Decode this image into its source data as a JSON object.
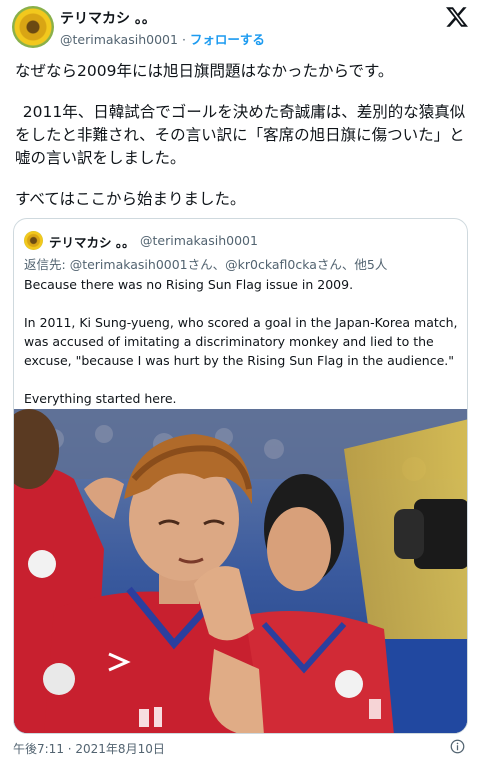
{
  "author": {
    "display_name": "テリマカシ 。。",
    "handle": "@terimakasih0001",
    "separator": "·",
    "follow_label": "フォローする"
  },
  "icons": {
    "brand": "x-logo-icon",
    "info": "info-icon",
    "avatar": "sunflower-avatar"
  },
  "tweet": {
    "line1": "なぜなら2009年には旭日旗問題はなかったからです。",
    "line2": "2011年、日韓試合でゴールを決めた奇誠庸は、差別的な猿真似をしたと非難され、その言い訳に「客席の旭日旗に傷ついた」と嘘の言い訳をしました。",
    "line3": "すべてはここから始まりました。"
  },
  "quote": {
    "display_name": "テリマカシ 。。",
    "handle": "@terimakasih0001",
    "reply_prefix": "返信先: ",
    "reply_mentions": "@terimakasih0001さん、@kr0ckafl0ckaさん、他5人",
    "text1": "Because there was no Rising Sun Flag issue in 2009.",
    "text2": "In 2011, Ki Sung-yueng, who scored a goal in the Japan-Korea match, was accused of imitating a discriminatory monkey and lied to the excuse, \"because I was hurt by the Rising Sun Flag in the audience.\"",
    "text3": "Everything started here."
  },
  "meta": {
    "timestamp": "午後7:11 · 2021年8月10日"
  },
  "colors": {
    "accent": "#1d9bf0",
    "text": "#0f1419",
    "muted": "#536471",
    "border": "#cfd9de",
    "jersey_red": "#c8202f"
  }
}
